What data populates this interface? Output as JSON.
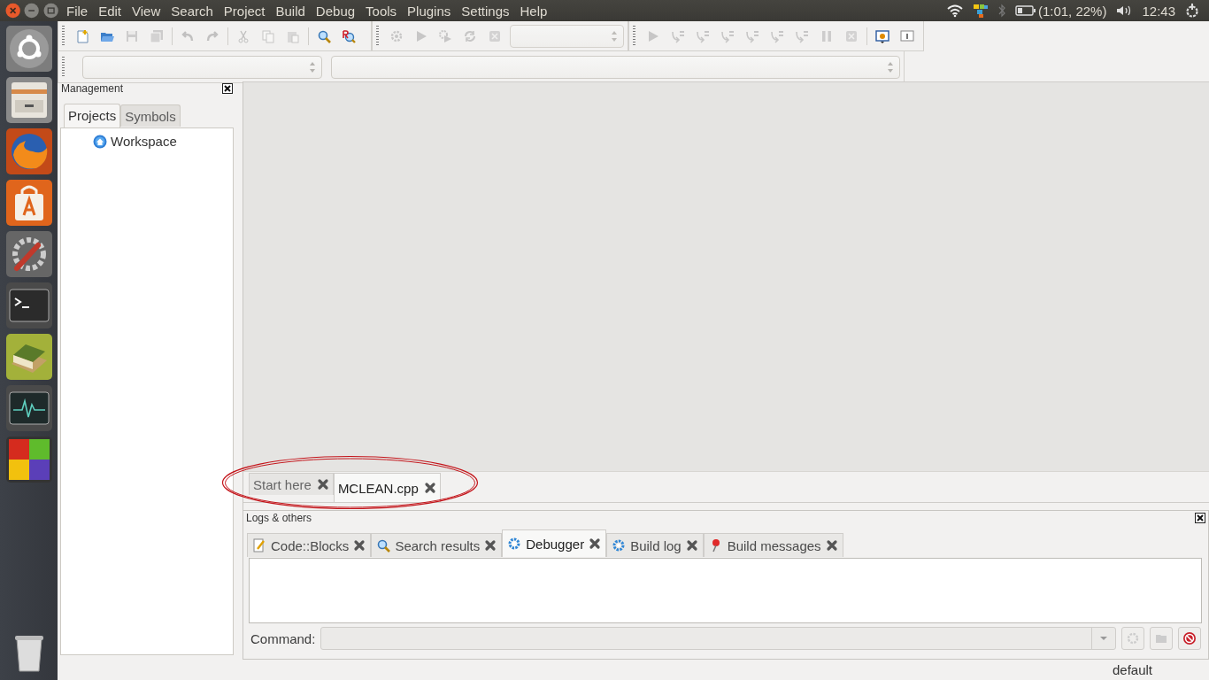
{
  "top_bar": {
    "menus": [
      "File",
      "Edit",
      "View",
      "Search",
      "Project",
      "Build",
      "Debug",
      "Tools",
      "Plugins",
      "Settings",
      "Help"
    ],
    "battery": "(1:01, 22%)",
    "clock": "12:43"
  },
  "toolbar_main": [
    {
      "kind": "new-file",
      "disabled": false
    },
    {
      "kind": "open",
      "disabled": false
    },
    {
      "kind": "save",
      "disabled": true
    },
    {
      "kind": "save-all",
      "disabled": true
    },
    {
      "kind": "sep"
    },
    {
      "kind": "undo",
      "disabled": true
    },
    {
      "kind": "redo",
      "disabled": true
    },
    {
      "kind": "sep"
    },
    {
      "kind": "cut",
      "disabled": true
    },
    {
      "kind": "copy",
      "disabled": true
    },
    {
      "kind": "paste",
      "disabled": true
    },
    {
      "kind": "sep"
    },
    {
      "kind": "find",
      "disabled": false
    },
    {
      "kind": "replace",
      "disabled": false
    }
  ],
  "toolbar_build": [
    {
      "kind": "gear",
      "disabled": true
    },
    {
      "kind": "run",
      "disabled": true
    },
    {
      "kind": "build-run",
      "disabled": true
    },
    {
      "kind": "rebuild",
      "disabled": true
    },
    {
      "kind": "abort",
      "disabled": true
    },
    {
      "kind": "combo",
      "disabled": true
    }
  ],
  "toolbar_debug": [
    {
      "kind": "run",
      "disabled": true
    },
    {
      "kind": "step",
      "disabled": true
    },
    {
      "kind": "step",
      "disabled": true
    },
    {
      "kind": "step",
      "disabled": true
    },
    {
      "kind": "step",
      "disabled": true
    },
    {
      "kind": "step",
      "disabled": true
    },
    {
      "kind": "step",
      "disabled": true
    },
    {
      "kind": "pause",
      "disabled": true
    },
    {
      "kind": "abort",
      "disabled": true
    },
    {
      "kind": "sep"
    },
    {
      "kind": "debug-window",
      "disabled": false
    },
    {
      "kind": "info",
      "disabled": false
    }
  ],
  "management": {
    "title": "Management",
    "tabs": [
      {
        "label": "Projects",
        "selected": true
      },
      {
        "label": "Symbols",
        "selected": false
      }
    ],
    "tree": [
      {
        "label": "Workspace"
      }
    ]
  },
  "editor": {
    "tabs": [
      {
        "label": "Start here",
        "selected": false
      },
      {
        "label": "MCLEAN.cpp",
        "selected": true
      }
    ]
  },
  "logs": {
    "title": "Logs & others",
    "tabs": [
      {
        "label": "Code::Blocks",
        "kind": "note",
        "selected": false
      },
      {
        "label": "Search results",
        "kind": "search",
        "selected": false
      },
      {
        "label": "Debugger",
        "kind": "gear",
        "selected": true
      },
      {
        "label": "Build log",
        "kind": "gear",
        "selected": false
      },
      {
        "label": "Build messages",
        "kind": "pin",
        "selected": false
      }
    ],
    "command_label": "Command:"
  },
  "status_bar": {
    "text": "default"
  }
}
